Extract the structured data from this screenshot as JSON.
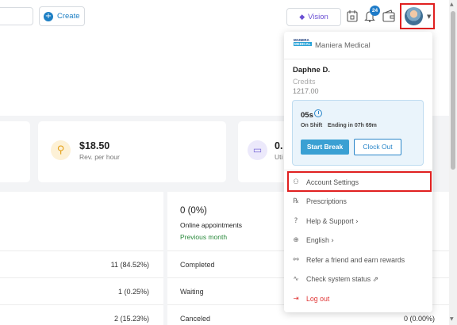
{
  "header": {
    "create_label": "Create",
    "vision_label": "Vision",
    "notification_count": "24"
  },
  "dashboard": {
    "rate_value": "$18.50",
    "rate_label": "Rev. per hour",
    "util_value": "0.",
    "util_label": "Uti",
    "online_pct": "0 (0%)",
    "online_label": "Online appointments",
    "period_label": "Previous month",
    "left_rows": [
      "11 (84.52%)",
      "1 (0.25%)",
      "2 (15.23%)"
    ],
    "right_rows": [
      {
        "label": "Completed",
        "value": ""
      },
      {
        "label": "Waiting",
        "value": ""
      },
      {
        "label": "Canceled",
        "value": "0 (0.00%)"
      }
    ]
  },
  "menu": {
    "org_logo_top": "MANERA",
    "org_logo_bottom": "MEDICAL",
    "org_name": "Maniera Medical",
    "user_name": "Daphne D.",
    "credits_label": "Credits",
    "credits_value": "1217.00",
    "shift_time": "05s",
    "on_shift": "On Shift",
    "ending": "Ending in 07h 69m",
    "start_break": "Start Break",
    "clock_out": "Clock Out",
    "items": [
      {
        "label": "Account Settings",
        "icon": "person-icon"
      },
      {
        "label": "Prescriptions",
        "icon": "prescription-icon"
      },
      {
        "label": "Help & Support",
        "icon": "help-icon"
      },
      {
        "label": "English",
        "icon": "globe-icon"
      },
      {
        "label": "Refer a friend and earn rewards",
        "icon": "refer-icon"
      },
      {
        "label": "Check system status",
        "icon": "pulse-icon"
      },
      {
        "label": "Log out",
        "icon": "logout-icon"
      }
    ],
    "highlighted_item": "Account Settings"
  },
  "colors": {
    "accent": "#1d7fc4",
    "highlight_border": "#e02020",
    "logout": "#e03535",
    "positive": "#2a8a3c"
  }
}
